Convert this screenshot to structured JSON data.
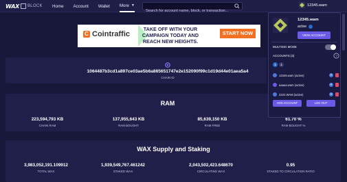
{
  "header": {
    "logo_text": "WAX",
    "logo_sub": "BLOCK",
    "nav": [
      {
        "label": "Home"
      },
      {
        "label": "Account"
      },
      {
        "label": "Wallet"
      },
      {
        "label": "More"
      }
    ],
    "search_placeholder": "Search for account name, block, or transaction...",
    "account_name": "12345.wam"
  },
  "ad": {
    "brand": "Cointraffic",
    "tagline": "TAKE OFF WITH YOUR CAMPAIGN TODAY AND REACH NEW HEIGHTS.",
    "cta": "START NOW"
  },
  "chain": {
    "id": "1064487b3cd1a897ce03ae5b6a865651747e2e152090f99c1d19d44e01aea5a4",
    "label": "CHAIN ID"
  },
  "ram": {
    "title": "RAM",
    "stats": [
      {
        "value": "223,594,793 KB",
        "label": "CHAIN RAM"
      },
      {
        "value": "137,955,643 KB",
        "label": "RAM BOUGHT"
      },
      {
        "value": "85,639,150 KB",
        "label": "RAM FREE"
      },
      {
        "value": "61.70 %",
        "label": "RAM BOUGHT %"
      }
    ]
  },
  "supply": {
    "title": "WAX Supply and Staking",
    "stats": [
      {
        "value": "3,983,052,191.109912",
        "label": "TOTAL WAX"
      },
      {
        "value": "1,939,549,767.461242",
        "label": "STAKED WAX"
      },
      {
        "value": "2,043,502,423.648670",
        "label": "CIRCULATING WAX"
      },
      {
        "value": "0.95",
        "label": "STAKED TO CIRCULATION RATIO"
      }
    ]
  },
  "dropdown": {
    "name": "12345.wam",
    "status": "active",
    "view_label": "VIEW ACCOUNT",
    "multisig_label": "MULTISIG MODE",
    "accounts_label": "ACCOUNTS (3)",
    "pages": [
      "1",
      "1"
    ],
    "accounts": [
      {
        "label": "12345.wam (active)"
      },
      {
        "label": "aaaaa.wam (active)"
      },
      {
        "label": "2222.WAM (active)"
      }
    ],
    "add_label": "ADD ACCOUNT",
    "logout_label": "LOG OUT"
  },
  "colors": {
    "background": "#17173a",
    "panel": "#1f1f4a",
    "accent": "#6a5ae8",
    "ad_orange": "#f36f22"
  }
}
